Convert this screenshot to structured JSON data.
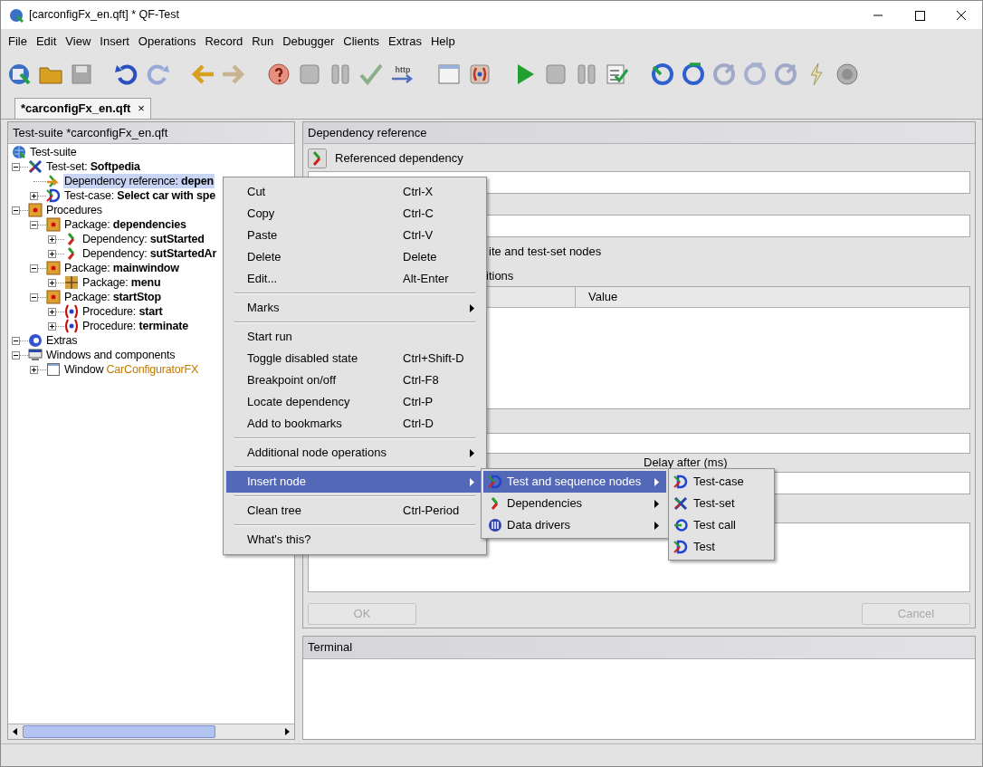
{
  "window": {
    "title": "[carconfigFx_en.qft] * QF-Test"
  },
  "menu_bar": [
    "File",
    "Edit",
    "View",
    "Insert",
    "Operations",
    "Record",
    "Run",
    "Debugger",
    "Clients",
    "Extras",
    "Help"
  ],
  "toolbar": {
    "http_label": "http"
  },
  "tabs": [
    {
      "label": "*carconfigFx_en.qft",
      "selected": true,
      "close": "×"
    }
  ],
  "tree_panel": {
    "title": "Test-suite *carconfigFx_en.qft",
    "nodes": [
      {
        "kind": "suite",
        "label": "Test-suite",
        "selected": false,
        "children": [
          {
            "kind": "testset",
            "label": "Test-set: **Softpedia**",
            "expanded": true,
            "selected": false,
            "children": [
              {
                "kind": "depref",
                "label": "Dependency reference: **depen**",
                "selected": true
              },
              {
                "kind": "testcase",
                "label": "Test-case: **Select car with spe**",
                "expanded": false,
                "selected": false
              }
            ]
          },
          {
            "kind": "package",
            "label": "Procedures",
            "expanded": true,
            "selected": false,
            "children": [
              {
                "kind": "package",
                "label": "Package: **dependencies**",
                "expanded": true,
                "selected": false,
                "children": [
                  {
                    "kind": "dependency",
                    "label": "Dependency: **sutStarted**",
                    "expanded": false,
                    "selected": false
                  },
                  {
                    "kind": "dependency",
                    "label": "Dependency: **sutStartedAr**",
                    "expanded": false,
                    "selected": false
                  }
                ]
              },
              {
                "kind": "package",
                "label": "Package: **mainwindow**",
                "expanded": true,
                "selected": false,
                "children": [
                  {
                    "kind": "grid",
                    "label": "Package: **menu**",
                    "expanded": false,
                    "selected": false
                  }
                ]
              },
              {
                "kind": "package",
                "label": "Package: **startStop**",
                "expanded": true,
                "selected": false,
                "children": [
                  {
                    "kind": "procedure",
                    "label": "Procedure: **start**",
                    "expanded": false,
                    "selected": false
                  },
                  {
                    "kind": "procedure",
                    "label": "Procedure: **terminate**",
                    "expanded": false,
                    "selected": false
                  }
                ]
              }
            ]
          },
          {
            "kind": "extras",
            "label": "Extras",
            "expanded": true,
            "selected": false
          },
          {
            "kind": "windows",
            "label": "Windows and components",
            "expanded": true,
            "selected": false,
            "children": [
              {
                "kind": "window",
                "label": "Window ",
                "name": "CarConfiguratorFX",
                "expanded": false,
                "selected": false
              }
            ]
          }
        ]
      }
    ]
  },
  "detail_panel": {
    "title": "Dependency reference",
    "referenced_label": "Referenced dependency",
    "checkbox_label": "ite and test-set nodes",
    "table_label": "itions",
    "table_columns": [
      "Value"
    ],
    "delay_after_label": "Delay after (ms)",
    "ok_button": {
      "label": "OK",
      "disabled": true
    },
    "cancel_button": {
      "label": "Cancel",
      "disabled": true
    }
  },
  "terminal": {
    "title": "Terminal"
  },
  "context_menu": [
    {
      "kind": "item",
      "label": "Cut",
      "shortcut": "Ctrl-X",
      "selected": false
    },
    {
      "kind": "item",
      "label": "Copy",
      "shortcut": "Ctrl-C",
      "selected": false
    },
    {
      "kind": "item",
      "label": "Paste",
      "shortcut": "Ctrl-V",
      "selected": false
    },
    {
      "kind": "item",
      "label": "Delete",
      "shortcut": "Delete",
      "selected": false
    },
    {
      "kind": "item",
      "label": "Edit...",
      "shortcut": "Alt-Enter",
      "selected": false
    },
    {
      "kind": "separator"
    },
    {
      "kind": "submenu",
      "label": "Marks",
      "selected": false
    },
    {
      "kind": "separator"
    },
    {
      "kind": "item",
      "label": "Start run",
      "selected": false
    },
    {
      "kind": "item",
      "label": "Toggle disabled state",
      "shortcut": "Ctrl+Shift-D",
      "selected": false
    },
    {
      "kind": "item",
      "label": "Breakpoint on/off",
      "shortcut": "Ctrl-F8",
      "selected": false
    },
    {
      "kind": "item",
      "label": "Locate dependency",
      "shortcut": "Ctrl-P",
      "selected": false
    },
    {
      "kind": "item",
      "label": "Add to bookmarks",
      "shortcut": "Ctrl-D",
      "selected": false
    },
    {
      "kind": "separator"
    },
    {
      "kind": "submenu",
      "label": "Additional node operations",
      "selected": false
    },
    {
      "kind": "separator"
    },
    {
      "kind": "submenu",
      "label": "Insert node",
      "selected": true
    },
    {
      "kind": "separator"
    },
    {
      "kind": "item",
      "label": "Clean tree",
      "shortcut": "Ctrl-Period",
      "selected": false
    },
    {
      "kind": "separator"
    },
    {
      "kind": "item",
      "label": "What's this?",
      "selected": false
    }
  ],
  "insert_submenu": [
    {
      "kind": "testcase",
      "label": "Test and sequence nodes",
      "selected": true
    },
    {
      "kind": "dependency",
      "label": "Dependencies",
      "selected": false
    },
    {
      "kind": "datadriver",
      "label": "Data drivers",
      "selected": false
    }
  ],
  "test_submenu": [
    {
      "kind": "testcase",
      "label": "Test-case",
      "selected": false
    },
    {
      "kind": "testset",
      "label": "Test-set",
      "selected": false
    },
    {
      "kind": "testcall",
      "label": "Test call",
      "selected": false
    },
    {
      "kind": "testcase",
      "label": "Test",
      "selected": false
    }
  ]
}
